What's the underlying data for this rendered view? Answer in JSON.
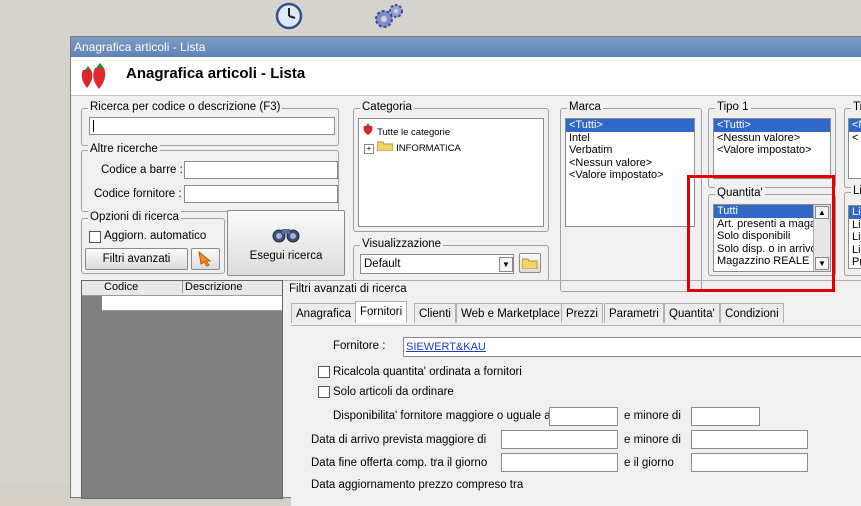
{
  "toolbar": {
    "clock_icon": "clock-icon",
    "gears_icon": "gears-icon"
  },
  "window": {
    "title": "Anagrafica articoli  - Lista",
    "header_title": "Anagrafica articoli  - Lista"
  },
  "search": {
    "label": "Ricerca per codice o descrizione (F3)",
    "value": "",
    "altre_label": "Altre ricerche",
    "barcode_label": "Codice a barre :",
    "supplier_code_label": "Codice fornitore :",
    "options_label": "Opzioni di ricerca",
    "auto_update_label": "Aggiorn. automatico",
    "advanced_filters_button": "Filtri avanzati",
    "execute_button": "Esegui ricerca"
  },
  "categoria": {
    "label": "Categoria",
    "items": [
      "Tutte le categorie",
      "INFORMATICA"
    ]
  },
  "visualizzazione": {
    "label": "Visualizzazione",
    "value": "Default"
  },
  "marca": {
    "label": "Marca",
    "items": [
      "<Tutti>",
      "Intel",
      "Verbatim",
      "<Nessun valore>",
      "<Valore impostato>"
    ]
  },
  "tipo1": {
    "label": "Tipo 1",
    "items": [
      "<Tutti>",
      "<Nessun valore>",
      "<Valore impostato>"
    ]
  },
  "tipo2": {
    "label": "Tip",
    "items": [
      "<N",
      "<"
    ]
  },
  "listino": {
    "label": "List",
    "items": [
      "List",
      "List",
      "List",
      "List",
      "Pro"
    ]
  },
  "quantita": {
    "label": "Quantita'",
    "items": [
      "Tutti",
      "Art. presenti a magaz",
      "Solo disponibili",
      "Solo disp. o in arrivo",
      "Magazzino REALE"
    ]
  },
  "grid": {
    "col_codice": "Codice",
    "col_descrizione": "Descrizione"
  },
  "advanced": {
    "label": "Filtri avanzati di ricerca",
    "tabs": [
      "Anagrafica",
      "Fornitori",
      "Clienti",
      "Web e Marketplace",
      "Prezzi",
      "Parametri",
      "Quantita'",
      "Condizioni"
    ],
    "fornitore_label": "Fornitore :",
    "fornitore_value": "SIEWERT&KAU",
    "ricalcola_label": "Ricalcola quantita' ordinata a fornitori",
    "solo_articoli_label": "Solo articoli da ordinare",
    "disponibilita_label": "Disponibilita' fornitore maggiore o uguale a",
    "e_minore_di_1": "e minore di",
    "data_arrivo_label": "Data di arrivo prevista maggiore di",
    "e_minore_di_2": "e minore di",
    "data_fine_label": "Data fine offerta comp. tra il giorno",
    "e_il_giorno": "e il giorno",
    "data_aggiornamento_label": "Data aggiornamento prezzo compreso tra"
  }
}
